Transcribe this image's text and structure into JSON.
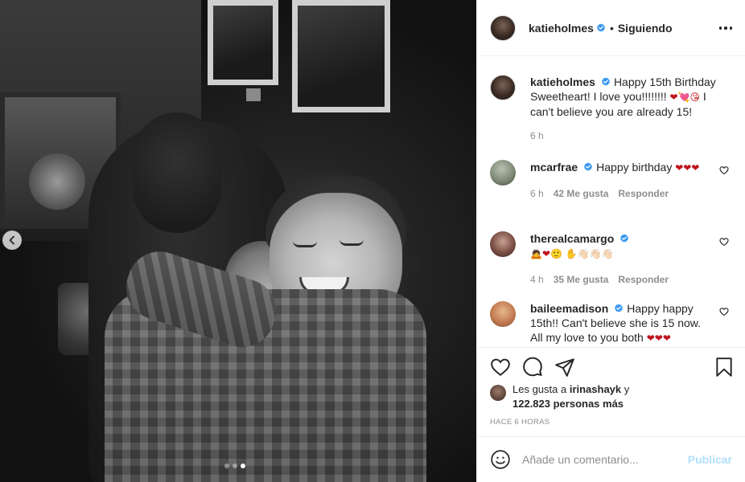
{
  "post": {
    "nav_prev": "previous-image",
    "carousel_count": 3,
    "carousel_active": 3
  },
  "header": {
    "username": "katieholmes",
    "separator": "•",
    "follow_status": "Siguiendo"
  },
  "caption": {
    "username": "katieholmes",
    "text_a": "Happy 15th Birthday Sweetheart! I love you!!!!!!!! ",
    "emojis": "❤💘😘",
    "text_b": " I can't believe you are already 15!",
    "time": "6 h"
  },
  "comments": [
    {
      "username": "mcarfrae",
      "text": "Happy birthday ",
      "emojis": "❤❤❤",
      "time": "6 h",
      "likes": "42 Me gusta",
      "reply": "Responder"
    },
    {
      "username": "therealcamargo",
      "text": "",
      "emojis": "🙇❤🙂 ✋👋🏻👋🏻👋🏻",
      "time": "4 h",
      "likes": "35 Me gusta",
      "reply": "Responder"
    },
    {
      "username": "baileemadison",
      "text": "Happy happy 15th!! Can't believe she is 15 now. All my love to you both ",
      "emojis": "❤❤❤"
    }
  ],
  "likes": {
    "prefix": "Les gusta a ",
    "user": "irinashayk",
    "suffix": " y",
    "others": "122.823 personas más"
  },
  "timestamp": "HACE 6 HORAS",
  "add_comment": {
    "placeholder": "Añade un comentario...",
    "publish": "Publicar"
  },
  "colors": {
    "verified": "#3897f0",
    "heart": "#c0131c",
    "publish_disabled": "#b2dffc",
    "muted": "#8e8e8e"
  }
}
